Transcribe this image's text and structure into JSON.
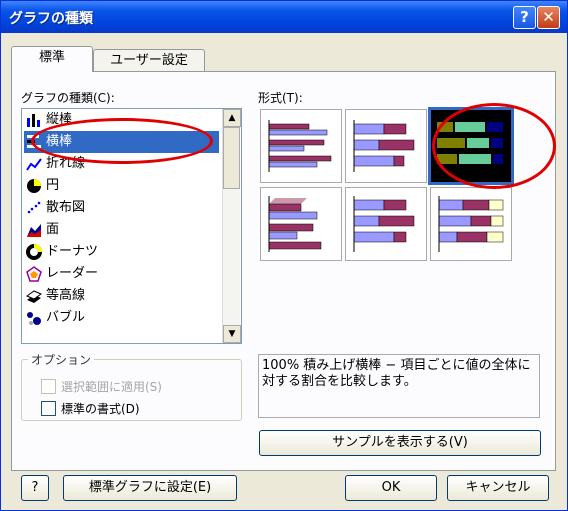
{
  "window": {
    "title": "グラフの種類",
    "help": "?",
    "close": "✕"
  },
  "tabs": [
    {
      "label": "標準"
    },
    {
      "label": "ユーザー設定"
    }
  ],
  "chart_type": {
    "label": "グラフの種類(C):",
    "items": [
      {
        "label": "縦棒",
        "icon": "column-chart-icon"
      },
      {
        "label": "横棒",
        "icon": "bar-chart-icon"
      },
      {
        "label": "折れ線",
        "icon": "line-chart-icon"
      },
      {
        "label": "円",
        "icon": "pie-chart-icon"
      },
      {
        "label": "散布図",
        "icon": "scatter-chart-icon"
      },
      {
        "label": "面",
        "icon": "area-chart-icon"
      },
      {
        "label": "ドーナツ",
        "icon": "doughnut-chart-icon"
      },
      {
        "label": "レーダー",
        "icon": "radar-chart-icon"
      },
      {
        "label": "等高線",
        "icon": "surface-chart-icon"
      },
      {
        "label": "バブル",
        "icon": "bubble-chart-icon"
      }
    ],
    "selected": "横棒"
  },
  "subtype": {
    "label": "形式(T):",
    "selected_index": 2
  },
  "options": {
    "label": "オプション",
    "apply_selection": "選択範囲に適用(S)",
    "default_format": "標準の書式(D)"
  },
  "description": "100% 積み上げ横棒 − 項目ごとに値の全体に対する割合を比較します。",
  "buttons": {
    "preview": "サンプルを表示する(V)",
    "set_default": "標準グラフに設定(E)",
    "ok": "OK",
    "cancel": "キャンセル"
  },
  "colors": {
    "bar1": "#993366",
    "bar2": "#9999ff",
    "bar3": "#ffffcc",
    "accent": "#316ac5",
    "highlight": "#e00000"
  }
}
